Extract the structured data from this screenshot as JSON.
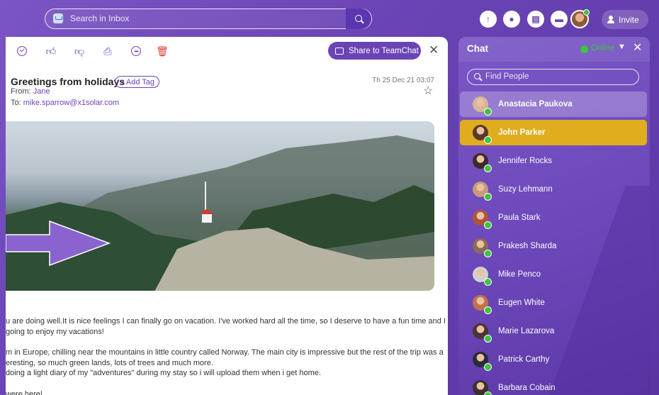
{
  "topbar": {
    "search_placeholder": "Search in Inbox",
    "invite_label": "Invite",
    "icons": [
      "inbox-icon",
      "search-icon",
      "upload-icon",
      "chat-bubble-icon",
      "calendar-icon",
      "message-icon",
      "user-avatar",
      "add-user-icon"
    ]
  },
  "mail": {
    "toolbar": {
      "share_label": "Share to TeamChat",
      "icons": [
        "check-circle-icon",
        "thumbs-up-icon",
        "thumbs-down-icon",
        "print-icon",
        "more-icon",
        "trash-icon",
        "close-icon"
      ]
    },
    "subject": "Greetings from holidays",
    "add_tag_label": "+ Add Tag",
    "from_label": "From:",
    "from_name": "Jane",
    "to_label": "To:",
    "to_address": "mike.sparrow@x1solar.com",
    "date": "Th 25 Dec 21 03:07",
    "body": {
      "line1": "u are doing well.It is nice feelings I can finally go on vacation. I've worked hard all the time, so I deserve to have a fun time and I",
      "line2": "going to enjoy my vacations!",
      "line3": "m in Europe, chilling near the mountains in little country called Norway. The main city is impressive but the rest of the trip was a",
      "line4": "eresting, so much green lands, lots of trees and much more.",
      "line5": "doing a light diary of my \"adventures\" during my stay so i will upload them when i get home.",
      "line6": "were here!"
    }
  },
  "chat": {
    "title": "Chat",
    "status": "Online",
    "find_placeholder": "Find People",
    "contacts": [
      {
        "name": "Anastacia Paukova",
        "state": "highlighted",
        "avatar_color": "#d8b79a"
      },
      {
        "name": "John Parker",
        "state": "selected",
        "avatar_color": "#5a3a2a"
      },
      {
        "name": "Jennifer Rocks",
        "state": "normal",
        "avatar_color": "#3a2a2a"
      },
      {
        "name": "Suzy Lehmann",
        "state": "normal",
        "avatar_color": "#c99a7a"
      },
      {
        "name": "Paula Stark",
        "state": "normal",
        "avatar_color": "#b0553a"
      },
      {
        "name": "Prakesh Sharda",
        "state": "normal",
        "avatar_color": "#8a6a5a"
      },
      {
        "name": "Mike Penco",
        "state": "normal",
        "avatar_color": "#d0d0d0"
      },
      {
        "name": "Eugen White",
        "state": "normal",
        "avatar_color": "#c0734a"
      },
      {
        "name": "Marie Lazarova",
        "state": "normal",
        "avatar_color": "#4a3530"
      },
      {
        "name": "Patrick Carthy",
        "state": "normal",
        "avatar_color": "#2a2a3a"
      },
      {
        "name": "Barbara Cobain",
        "state": "normal",
        "avatar_color": "#3a3030"
      }
    ]
  },
  "colors": {
    "accent": "#6a44b5",
    "selected": "#e0ad1f",
    "online": "#3ec43e",
    "delete": "#e53935"
  }
}
